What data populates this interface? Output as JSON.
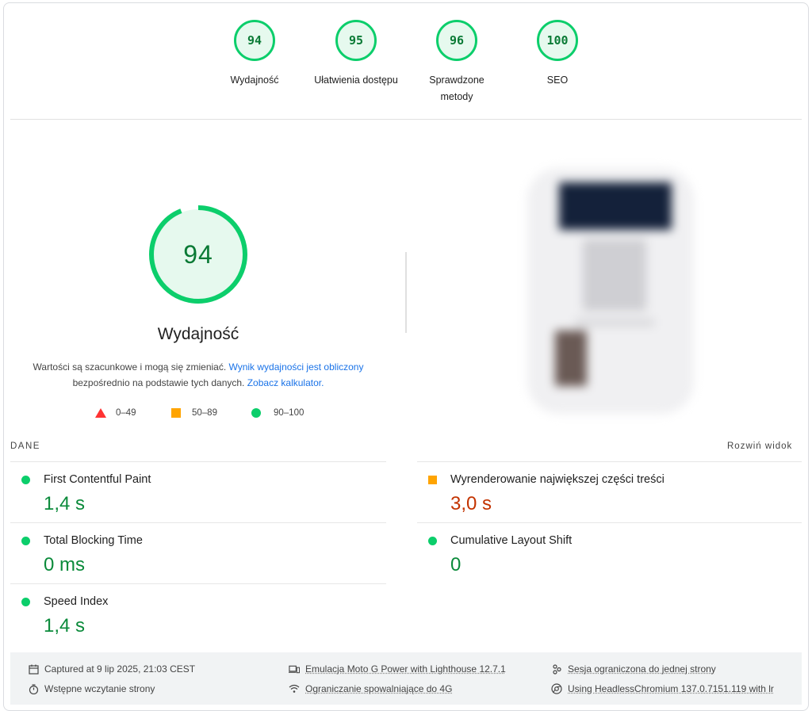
{
  "categories": [
    {
      "score": "94",
      "label": "Wydajność"
    },
    {
      "score": "95",
      "label": "Ułatwienia dostępu"
    },
    {
      "score": "96",
      "label": "Sprawdzone metody"
    },
    {
      "score": "100",
      "label": "SEO"
    }
  ],
  "performance": {
    "score": "94",
    "score_fraction": 0.94,
    "title": "Wydajność",
    "note_text1": "Wartości są szacunkowe i mogą się zmieniać. ",
    "note_link1": "Wynik wydajności jest obliczony",
    "note_text2": " bezpośrednio na podstawie tych danych. ",
    "note_link2": "Zobacz kalkulator."
  },
  "legend": {
    "fail": "0–49",
    "average": "50–89",
    "pass": "90–100"
  },
  "data_section": {
    "label": "DANE",
    "expand": "Rozwiń widok"
  },
  "metrics": {
    "fcp": {
      "name": "First Contentful Paint",
      "value": "1,4 s"
    },
    "lcp": {
      "name": "Wyrenderowanie największej części treści",
      "value": "3,0 s"
    },
    "tbt": {
      "name": "Total Blocking Time",
      "value": "0 ms"
    },
    "cls": {
      "name": "Cumulative Layout Shift",
      "value": "0"
    },
    "si": {
      "name": "Speed Index",
      "value": "1,4 s"
    }
  },
  "footer": {
    "captured": "Captured at 9 lip 2025, 21:03 CEST",
    "emulation": "Emulacja Moto G Power with Lighthouse 12.7.1",
    "session": "Sesja ograniczona do jednej strony",
    "initial_load": "Wstępne wczytanie strony",
    "throttling": "Ograniczanie spowalniające do 4G",
    "browser": "Using HeadlessChromium 137.0.7151.119 with lr"
  },
  "colors": {
    "pass": "#0cce6b",
    "average": "#ffa400",
    "fail": "#ff3333",
    "link": "#1a73e8"
  }
}
